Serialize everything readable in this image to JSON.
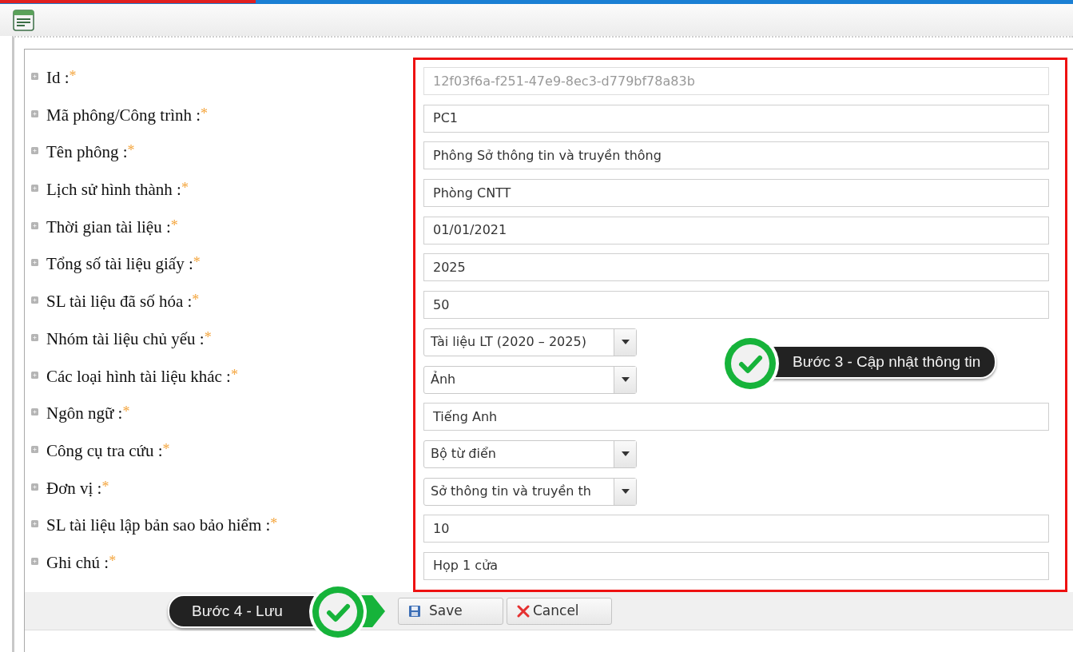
{
  "fields": [
    {
      "label": "Id :",
      "marker": "*",
      "kind": "text",
      "value": "12f03f6a-f251-47e9-8ec3-d779bf78a83b",
      "disabled": true
    },
    {
      "label": "Mã phông/Công trình :",
      "marker": "*",
      "kind": "text",
      "value": "PC1",
      "disabled": false
    },
    {
      "label": "Tên phông :",
      "marker": "*",
      "kind": "text",
      "value": "Phông Sở thông tin và truyền thông",
      "disabled": false
    },
    {
      "label": "Lịch sử hình thành :",
      "marker": "*",
      "kind": "text",
      "value": "Phòng CNTT",
      "disabled": false
    },
    {
      "label": "Thời gian tài liệu :",
      "marker": "*",
      "kind": "text",
      "value": "01/01/2021",
      "disabled": false
    },
    {
      "label": "Tổng số tài liệu giấy :",
      "marker": "*",
      "kind": "text",
      "value": "2025",
      "disabled": false
    },
    {
      "label": "SL tài liệu đã số hóa :",
      "marker": "*",
      "kind": "text",
      "value": "50",
      "disabled": false
    },
    {
      "label": "Nhóm tài liệu chủ yếu :",
      "marker": "*",
      "kind": "select",
      "value": "Tài liệu LT (2020 – 2025)",
      "disabled": false
    },
    {
      "label": "Các loại hình tài liệu khác :",
      "marker": "*",
      "kind": "select",
      "value": "Ảnh",
      "disabled": false
    },
    {
      "label": "Ngôn ngữ :",
      "marker": "*",
      "kind": "text",
      "value": "Tiếng Anh",
      "disabled": false
    },
    {
      "label": "Công cụ tra cứu :",
      "marker": "*",
      "kind": "select",
      "value": "Bộ từ điển",
      "disabled": false
    },
    {
      "label": "Đơn vị :",
      "marker": "*",
      "kind": "select",
      "value": "Sở thông tin và truyền th",
      "disabled": false
    },
    {
      "label": "SL tài liệu lập bản sao bảo hiểm :",
      "marker": "*",
      "kind": "text",
      "value": "10",
      "disabled": false
    },
    {
      "label": "Ghi chú :",
      "marker": "*",
      "kind": "text",
      "value": "Họp 1 cửa",
      "disabled": false
    }
  ],
  "buttons": [
    {
      "label": "Save",
      "kind": "save"
    },
    {
      "label": "Cancel",
      "kind": "cancel"
    }
  ],
  "callouts": [
    {
      "text": "Bước 3 - Cập nhật thông tin",
      "kind": "step3"
    },
    {
      "text": "Bước 4 - Lưu",
      "kind": "step4"
    }
  ]
}
